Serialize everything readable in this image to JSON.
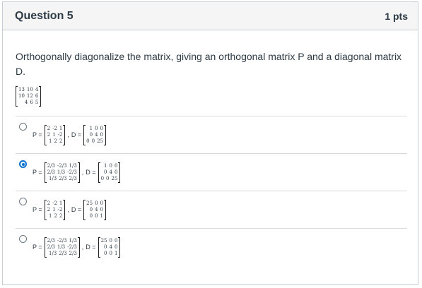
{
  "header": {
    "title": "Question 5",
    "points": "1 pts"
  },
  "prompt": "Orthogonally diagonalize the matrix, giving an orthogonal matrix P and a diagonal matrix D.",
  "given_matrix": [
    [
      "13",
      "10",
      "4"
    ],
    [
      "10",
      "12",
      "6"
    ],
    [
      "4",
      "6",
      "5"
    ]
  ],
  "labels": {
    "p": "P =",
    "d": "D =",
    "comma": ","
  },
  "answers": [
    {
      "checked": false,
      "P": [
        [
          "2",
          "-2",
          "1"
        ],
        [
          "2",
          "1",
          "-2"
        ],
        [
          "1",
          "2",
          "2"
        ]
      ],
      "D": [
        [
          "1",
          "0",
          "0"
        ],
        [
          "0",
          "4",
          "0"
        ],
        [
          "0",
          "0",
          "25"
        ]
      ]
    },
    {
      "checked": true,
      "P": [
        [
          "2/3",
          "-2/3",
          "1/3"
        ],
        [
          "2/3",
          "1/3",
          "-2/3"
        ],
        [
          "1/3",
          "2/3",
          "2/3"
        ]
      ],
      "D": [
        [
          "1",
          "0",
          "0"
        ],
        [
          "0",
          "4",
          "0"
        ],
        [
          "0",
          "0",
          "25"
        ]
      ]
    },
    {
      "checked": false,
      "P": [
        [
          "2",
          "-2",
          "1"
        ],
        [
          "2",
          "1",
          "-2"
        ],
        [
          "1",
          "2",
          "2"
        ]
      ],
      "D": [
        [
          "25",
          "0",
          "0"
        ],
        [
          "0",
          "4",
          "0"
        ],
        [
          "0",
          "0",
          "1"
        ]
      ]
    },
    {
      "checked": false,
      "P": [
        [
          "2/3",
          "-2/3",
          "1/3"
        ],
        [
          "2/3",
          "1/3",
          "-2/3"
        ],
        [
          "1/3",
          "2/3",
          "2/3"
        ]
      ],
      "D": [
        [
          "25",
          "0",
          "0"
        ],
        [
          "0",
          "4",
          "0"
        ],
        [
          "0",
          "0",
          "1"
        ]
      ]
    }
  ],
  "colors": {
    "accent": "#0770cf",
    "text": "#2d3b45",
    "header_bg": "#f5f5f5",
    "border": "#c7cdd1"
  }
}
